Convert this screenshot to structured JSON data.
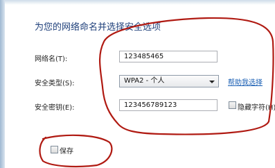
{
  "dialog": {
    "heading": "为您的网络命名并选择安全选项",
    "network_name": {
      "label": "网络名(T):",
      "value": "123485465"
    },
    "security_type": {
      "label": "安全类型(S):",
      "value": "WPA2 - 个人"
    },
    "help_link": "帮助我选择",
    "security_key": {
      "label": "安全密钥(E):",
      "value": "123456789123"
    },
    "hide_chars": {
      "label": "隐藏字符(H)",
      "checked": false
    },
    "save_network": {
      "label": "保存",
      "checked": false
    }
  },
  "annotation_color": "#b01a12"
}
